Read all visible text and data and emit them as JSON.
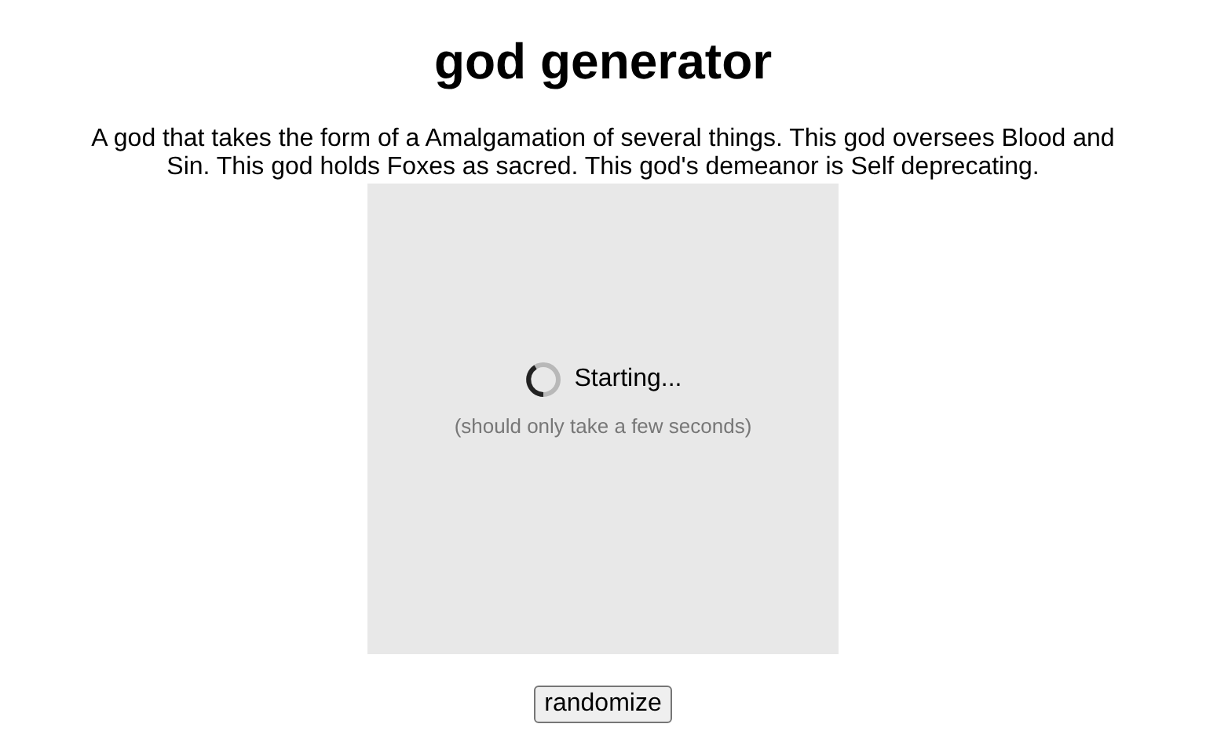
{
  "title": "god generator",
  "description": "A god that takes the form of a Amalgamation of several things. This god oversees Blood and Sin. This god holds Foxes as sacred. This god's demeanor is Self deprecating.",
  "loader": {
    "status": "Starting...",
    "note": "(should only take a few seconds)"
  },
  "buttons": [
    "randomize"
  ]
}
